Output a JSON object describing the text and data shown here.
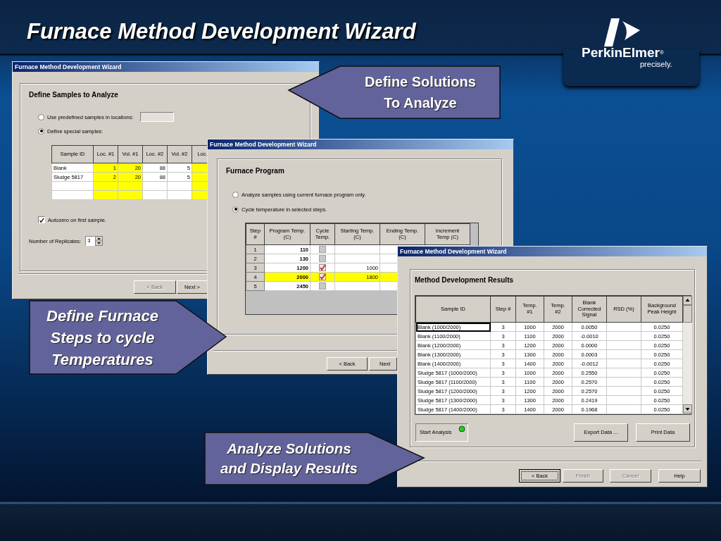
{
  "slide": {
    "title": "Furnace Method Development Wizard"
  },
  "logo": {
    "brand": "PerkinElmer$^{®}$",
    "tagline": "precisely."
  },
  "samples_window": {
    "title": "Furnace Method Development Wizard",
    "heading": "Define Samples to Analyze",
    "options": [
      {
        "label": "Use predefined samples in locations:",
        "selected": false,
        "kind": "field"
      },
      {
        "label": "Define special samples:",
        "selected": true,
        "kind": "plain"
      }
    ],
    "columns": [
      {
        "label": "Sample ID",
        "highlighted": false
      },
      {
        "label": "Loc. #1",
        "highlighted": true
      },
      {
        "label": "Vol. #1",
        "highlighted": true
      },
      {
        "label": "Loc. #2",
        "highlighted": false
      },
      {
        "label": "Vol. #2",
        "highlighted": false
      },
      {
        "label": "Loc.",
        "highlighted": true
      }
    ],
    "rows": [
      {
        "kind": "data",
        "cells": [
          "Blank",
          "1",
          "20",
          "88",
          "5"
        ]
      },
      {
        "kind": "data",
        "cells": [
          "Sludge 5817",
          "2",
          "20",
          "88",
          "5"
        ]
      },
      {
        "kind": "blank"
      },
      {
        "kind": "blank"
      }
    ],
    "autozero": {
      "label": "Autozero on first sample.",
      "checked": true
    },
    "replicates": {
      "label": "Number of Replicates:",
      "value": "3"
    },
    "buttons": [
      {
        "label": "< Back",
        "disabled": true
      },
      {
        "label": "Next >",
        "disabled": false
      }
    ]
  },
  "program_window": {
    "title": "Furnace Method Development Wizard",
    "heading": "Furnace Program",
    "options": [
      {
        "label": "Analyze samples using current furnace program only.",
        "selected": false
      },
      {
        "label": "Cycle temperature in selected steps.",
        "selected": true
      }
    ],
    "columns": [
      "Step\n#",
      "Program Temp.\n(C)",
      "Cycle\nTemp.",
      "Starting Temp.\n(C)",
      "Ending Temp.\n(C)",
      "Increment\nTemp (C)"
    ],
    "rows": [
      {
        "step": "1",
        "temp": "110",
        "cycle": false,
        "selected": false
      },
      {
        "step": "2",
        "temp": "130",
        "cycle": false,
        "selected": false
      },
      {
        "step": "3",
        "temp": "1200",
        "cycle": true,
        "start": "1000",
        "selected": false
      },
      {
        "step": "4",
        "temp": "2000",
        "cycle": true,
        "start": "1800",
        "selected": true
      },
      {
        "step": "5",
        "temp": "2450",
        "cycle": false,
        "selected": false
      }
    ],
    "buttons": [
      {
        "label": "< Back",
        "disabled": false
      },
      {
        "label": "Next",
        "disabled": false
      }
    ]
  },
  "results_window": {
    "title": "Furnace Method Development Wizard",
    "heading": "Method Development Results",
    "columns": [
      "Sample ID",
      "Step #",
      "Temp.\n#1",
      "Temp.\n#2",
      "Blank\nCorrected\nSignal",
      "RSD (%)",
      "Background\nPeak Height"
    ],
    "rows": [
      {
        "sample": "Blank (1000/2000)",
        "step": "3",
        "temp1": "1000",
        "temp2": "2000",
        "signal": "0.0050",
        "background": "0.0250",
        "selected": true
      },
      {
        "sample": "Blank (1100/2000)",
        "step": "3",
        "temp1": "1100",
        "temp2": "2000",
        "signal": "-0.0010",
        "background": "0.0250",
        "selected": false
      },
      {
        "sample": "Blank (1200/2000)",
        "step": "3",
        "temp1": "1200",
        "temp2": "2000",
        "signal": "0.0000",
        "background": "0.0250",
        "selected": false
      },
      {
        "sample": "Blank (1300/2000)",
        "step": "3",
        "temp1": "1300",
        "temp2": "2000",
        "signal": "0.0003",
        "background": "0.0250",
        "selected": false
      },
      {
        "sample": "Blank (1400/2000)",
        "step": "3",
        "temp1": "1400",
        "temp2": "2000",
        "signal": "-0.0012",
        "background": "0.0250",
        "selected": false
      },
      {
        "sample": "Sludge 5817 (1000/2000)",
        "step": "3",
        "temp1": "1000",
        "temp2": "2000",
        "signal": "0.2550",
        "background": "0.0250",
        "selected": false
      },
      {
        "sample": "Sludge 5817 (1100/2000)",
        "step": "3",
        "temp1": "1100",
        "temp2": "2000",
        "signal": "0.2570",
        "background": "0.0250",
        "selected": false
      },
      {
        "sample": "Sludge 5817 (1200/2000)",
        "step": "3",
        "temp1": "1200",
        "temp2": "2000",
        "signal": "0.2570",
        "background": "0.0250",
        "selected": false
      },
      {
        "sample": "Sludge 5817 (1300/2000)",
        "step": "3",
        "temp1": "1300",
        "temp2": "2000",
        "signal": "0.2419",
        "background": "0.0250",
        "selected": false
      },
      {
        "sample": "Sludge 5817 (1400/2000)",
        "step": "3",
        "temp1": "1400",
        "temp2": "2000",
        "signal": "0.1968",
        "background": "0.0250",
        "selected": false
      }
    ],
    "start_button": {
      "label": "Start Analysis"
    },
    "actions": [
      {
        "label": "Export Data ..."
      },
      {
        "label": "Print Data"
      }
    ],
    "buttons": [
      {
        "label": "< Back",
        "disabled": false,
        "focused": true
      },
      {
        "label": "Finish",
        "disabled": true,
        "focused": false
      },
      {
        "label": "Cancel",
        "disabled": true,
        "focused": false
      },
      {
        "label": "Help",
        "disabled": false,
        "focused": false
      }
    ]
  },
  "callouts": [
    {
      "lines": [
        "Define Solutions",
        "To Analyze"
      ],
      "italic": false
    },
    {
      "lines": [
        "Define Furnace",
        "Steps to cycle",
        "Temperatures"
      ],
      "italic": true
    },
    {
      "lines": [
        "Analyze Solutions",
        "and Display Results"
      ],
      "italic": true
    }
  ]
}
